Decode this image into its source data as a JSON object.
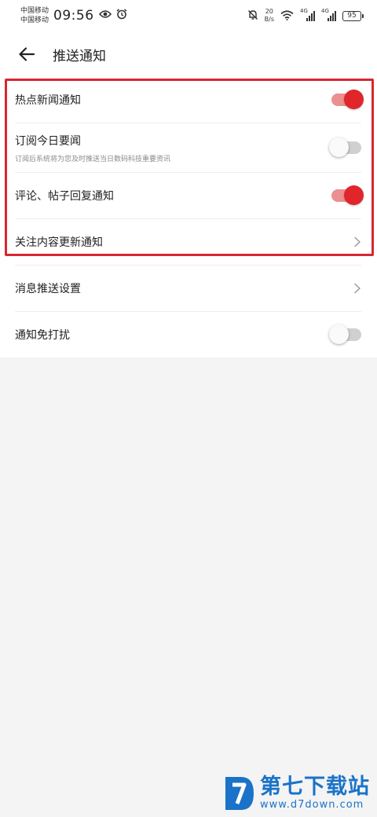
{
  "status_bar": {
    "carrier1": "中国移动",
    "carrier2": "中国移动",
    "time": "09:56",
    "net_speed_value": "20",
    "net_speed_unit": "B/s",
    "sim1_tag": "4G",
    "sim2_tag": "4G",
    "battery": "95"
  },
  "header": {
    "title": "推送通知"
  },
  "settings": {
    "hot_news": {
      "label": "热点新闻通知",
      "enabled": true
    },
    "daily_news": {
      "label": "订阅今日要闻",
      "subtitle": "订阅后系统将为您及时推送当日数码科技重要资讯",
      "enabled": false
    },
    "reply_notify": {
      "label": "评论、帖子回复通知",
      "enabled": true
    },
    "follow_update": {
      "label": "关注内容更新通知"
    },
    "push_settings": {
      "label": "消息推送设置"
    },
    "do_not_disturb": {
      "label": "通知免打扰",
      "enabled": false
    }
  },
  "colors": {
    "accent": "#e0262b",
    "track_on": "#eb8f90",
    "highlight": "#d9262f",
    "watermark": "#1a73c8"
  },
  "watermark": {
    "name": "第七下载站",
    "url": "www.d7down.com"
  }
}
